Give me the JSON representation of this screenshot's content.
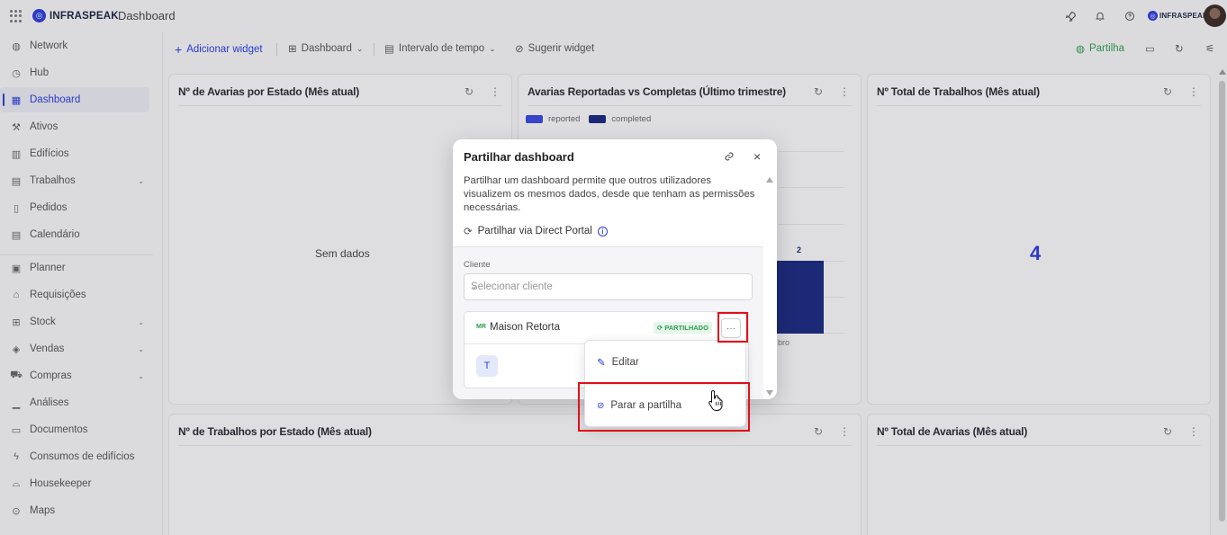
{
  "topbar": {
    "brand": "INFRASPEAK",
    "title": "Dashboard",
    "org_brand": "INFRASPEAK"
  },
  "sidebar": {
    "items": [
      {
        "label": "Network",
        "icon": "globe-icon"
      },
      {
        "label": "Hub",
        "icon": "clock-icon"
      },
      {
        "label": "Dashboard",
        "icon": "dashboard-icon"
      },
      {
        "label": "Ativos",
        "icon": "tool-icon"
      },
      {
        "label": "Edifícios",
        "icon": "building-icon"
      },
      {
        "label": "Trabalhos",
        "icon": "calendar-icon"
      },
      {
        "label": "Pedidos",
        "icon": "clipboard-icon"
      },
      {
        "label": "Calendário",
        "icon": "calendar-icon"
      },
      {
        "label": "Planner",
        "icon": "planner-icon"
      },
      {
        "label": "Requisições",
        "icon": "requisition-icon"
      },
      {
        "label": "Stock",
        "icon": "stock-icon"
      },
      {
        "label": "Vendas",
        "icon": "tag-icon"
      },
      {
        "label": "Compras",
        "icon": "cart-icon"
      },
      {
        "label": "Análises",
        "icon": "chart-icon"
      },
      {
        "label": "Documentos",
        "icon": "document-icon"
      },
      {
        "label": "Consumos de edifícios",
        "icon": "bolt-icon"
      },
      {
        "label": "Housekeeper",
        "icon": "bed-icon"
      },
      {
        "label": "Maps",
        "icon": "pin-icon"
      }
    ]
  },
  "toolbar": {
    "add_widget": "Adicionar widget",
    "dashboard": "Dashboard",
    "time_range": "Intervalo de tempo",
    "suggest": "Sugerir widget",
    "share": "Partilha"
  },
  "cards": {
    "c1": {
      "title": "Nº de Avarias por Estado (Mês atual)",
      "empty": "Sem dados"
    },
    "c2": {
      "title": "Avarias Reportadas vs Completas (Último trimestre)",
      "legend_reported": "reported",
      "legend_completed": "completed",
      "bar_label": "2",
      "partial_tick": "bro"
    },
    "c3": {
      "title": "Nº Total de Trabalhos (Mês atual)",
      "value": "4"
    },
    "c4": {
      "title": "Nº de Trabalhos por Estado (Mês atual)"
    },
    "c5": {
      "title": "Nº Total de Avarias (Mês atual)"
    }
  },
  "modal": {
    "title": "Partilhar dashboard",
    "description": "Partilhar um dashboard permite que outros utilizadores visualizem os mesmos dados, desde que tenham as permissões necessárias.",
    "portal_label": "Partilhar via Direct Portal",
    "client_label": "Cliente",
    "client_placeholder": "Selecionar cliente",
    "client_name": "Maison Retorta",
    "client_initials": "MR",
    "badge": "PARTILHADO",
    "user_initial": "T"
  },
  "menu": {
    "edit": "Editar",
    "stop": "Parar a partilha"
  },
  "colors": {
    "accent": "#2b3ddb",
    "reported": "#3949e0",
    "completed": "#1b2a80",
    "green": "#2f9c4e",
    "highlight": "#e0101a"
  }
}
